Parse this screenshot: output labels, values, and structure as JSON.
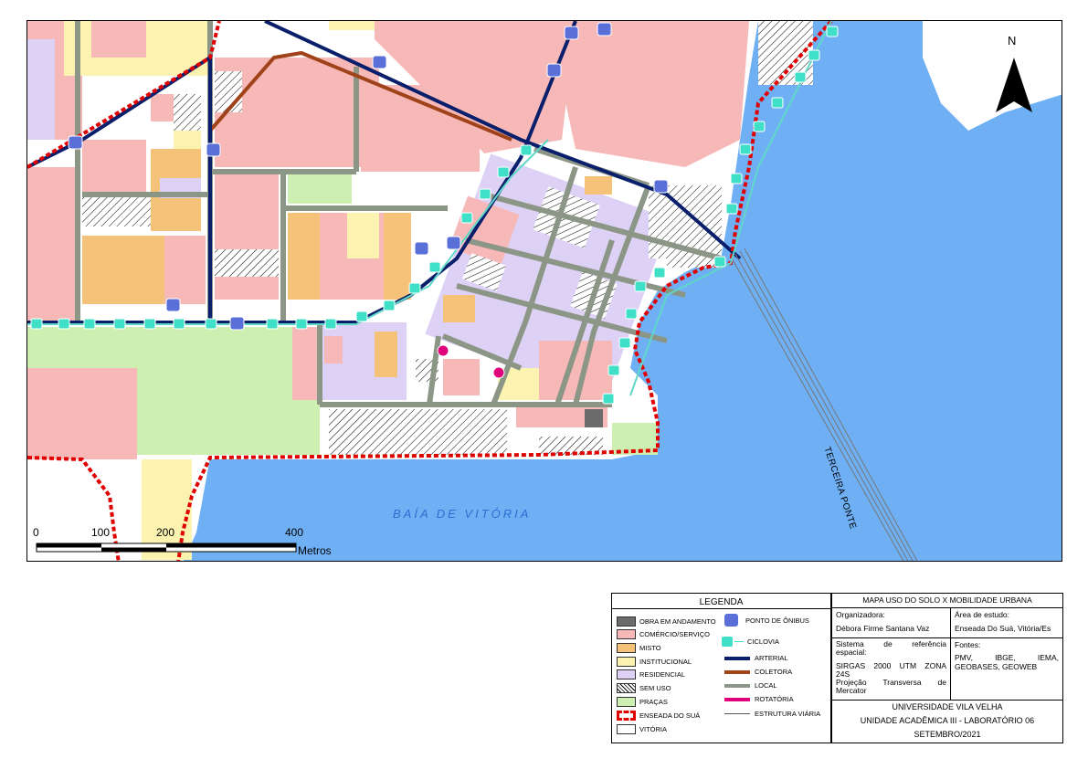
{
  "map": {
    "bay_label": "BAÍA DE VITÓRIA",
    "bridge_label": "TERCEIRA PONTE",
    "north_label": "N",
    "scale": {
      "ticks": [
        "0",
        "100",
        "200",
        "400"
      ],
      "unit": "Metros"
    }
  },
  "legend": {
    "title": "LEGENDA",
    "items": [
      {
        "label": "OBRA EM ANDAMENTO",
        "color": "#6b6b6b"
      },
      {
        "label": "COMÉRCIO/SERVIÇO",
        "color": "#f7b8b8"
      },
      {
        "label": "MISTO",
        "color": "#f5c27a"
      },
      {
        "label": "INSTITUCIONAL",
        "color": "#fcf3b0"
      },
      {
        "label": "RESIDENCIAL",
        "color": "#ddd2f5"
      },
      {
        "label": "SEM USO",
        "color": "hatch"
      },
      {
        "label": "PRAÇAS",
        "color": "#cdf0b2"
      },
      {
        "label": "ENSEADA DO SUÁ",
        "color": "#e00000"
      },
      {
        "label": "VITÓRIA",
        "color": "#ffffff"
      },
      {
        "label": "PONTO DE ÔNIBUS",
        "icon": "bus-stop-icon"
      },
      {
        "label": "CICLOVIA",
        "icon": "bicycle-icon"
      },
      {
        "label": "ARTERIAL",
        "color": "#0a1f6b"
      },
      {
        "label": "COLETORA",
        "color": "#a0431a"
      },
      {
        "label": "LOCAL",
        "color": "#8c9686"
      },
      {
        "label": "ROTATÓRIA",
        "color": "#e0007a"
      },
      {
        "label": "ESTRUTURA VIÁRIA",
        "color": "#555555"
      }
    ]
  },
  "info": {
    "title": "MAPA USO DO SOLO X MOBILIDADE URBANA",
    "organizer_label": "Organizadora:",
    "organizer": "Débora Firme Santana Vaz",
    "area_label": "Área de estudo:",
    "area": "Enseada Do Suá, Vitória/Es",
    "crs_label_1": "Sistema de referência",
    "crs_label_2": "espacial:",
    "crs_1": "SIRGAS 2000 UTM ZONA",
    "crs_2": "24S",
    "crs_3": "Projeção Transversa de",
    "crs_4": "Mercator",
    "sources_label": "Fontes:",
    "sources_1": "PMV, IBGE, IEMA,",
    "sources_2": "GEOBASES, GEOWEB",
    "university": "UNIVERSIDADE VILA VELHA",
    "unit": "UNIDADE ACADÊMICA III - LABORATÓRIO 06",
    "date": "SETEMBRO/2021"
  }
}
